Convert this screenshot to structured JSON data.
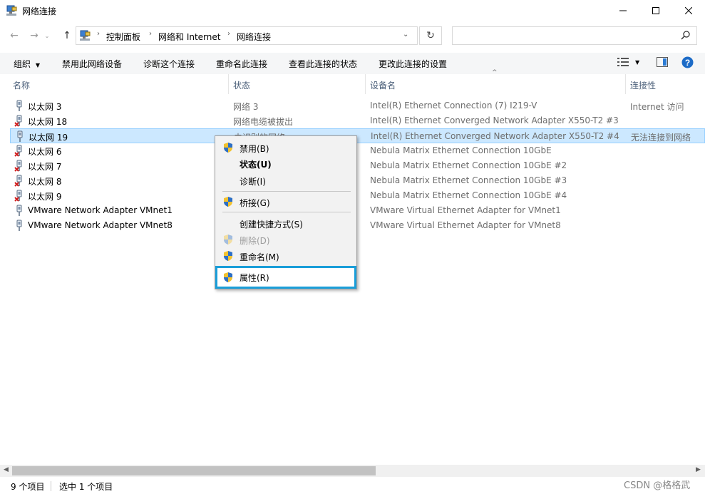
{
  "window": {
    "title": "网络连接",
    "minimize_icon": "minimize-icon",
    "maximize_icon": "maximize-icon",
    "close_icon": "close-icon"
  },
  "address": {
    "breadcrumbs": [
      "控制面板",
      "网络和 Internet",
      "网络连接"
    ],
    "search_placeholder": ""
  },
  "toolbar": {
    "organize": "组织",
    "disable": "禁用此网络设备",
    "diagnose": "诊断这个连接",
    "rename": "重命名此连接",
    "view_status": "查看此连接的状态",
    "change_settings": "更改此连接的设置"
  },
  "columns": {
    "name": "名称",
    "status": "状态",
    "device": "设备名",
    "connectivity": "连接性"
  },
  "rows": [
    {
      "name": "以太网 3",
      "status": "网络 3",
      "device": "Intel(R) Ethernet Connection (7) I219-V",
      "connectivity": "Internet 访问",
      "disconnected": false
    },
    {
      "name": "以太网 18",
      "status": "网络电缆被拔出",
      "device": "Intel(R) Ethernet Converged Network Adapter X550-T2 #3",
      "connectivity": "",
      "disconnected": true
    },
    {
      "name": "以太网 19",
      "status": "未识别的网络",
      "device": "Intel(R) Ethernet Converged Network Adapter X550-T2 #4",
      "connectivity": "无法连接到网络",
      "disconnected": false
    },
    {
      "name": "以太网 6",
      "status": "",
      "device": "Nebula Matrix Ethernet Connection 10GbE",
      "connectivity": "",
      "disconnected": true
    },
    {
      "name": "以太网 7",
      "status": "",
      "device": "Nebula Matrix Ethernet Connection 10GbE #2",
      "connectivity": "",
      "disconnected": true
    },
    {
      "name": "以太网 8",
      "status": "",
      "device": "Nebula Matrix Ethernet Connection 10GbE #3",
      "connectivity": "",
      "disconnected": true
    },
    {
      "name": "以太网 9",
      "status": "",
      "device": "Nebula Matrix Ethernet Connection 10GbE #4",
      "connectivity": "",
      "disconnected": true
    },
    {
      "name": "VMware Network Adapter VMnet1",
      "status": "",
      "device": "VMware Virtual Ethernet Adapter for VMnet1",
      "connectivity": "",
      "disconnected": false
    },
    {
      "name": "VMware Network Adapter VMnet8",
      "status": "",
      "device": "VMware Virtual Ethernet Adapter for VMnet8",
      "connectivity": "",
      "disconnected": false
    }
  ],
  "context_menu": {
    "disable": "禁用(B)",
    "status": "状态(U)",
    "diagnose": "诊断(I)",
    "bridge": "桥接(G)",
    "shortcut": "创建快捷方式(S)",
    "delete": "删除(D)",
    "rename": "重命名(M)",
    "properties": "属性(R)"
  },
  "statusbar": {
    "count": "9 个项目",
    "selected": "选中 1 个项目"
  },
  "watermark": "CSDN @格格武",
  "colors": {
    "selection": "#cce8ff",
    "highlight_border": "#1a9ed9",
    "help_blue": "#1c6bc7"
  }
}
